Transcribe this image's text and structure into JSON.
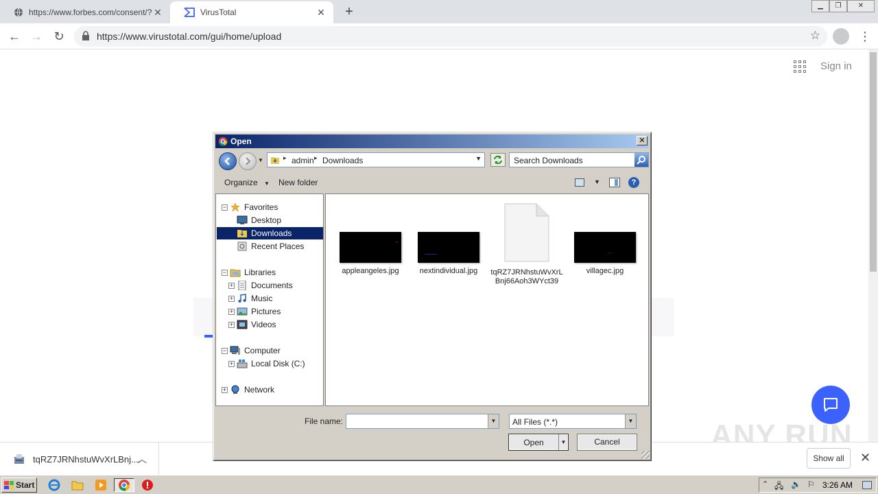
{
  "browser": {
    "tabs": [
      {
        "title": "https://www.forbes.com/consent/?t",
        "active": false,
        "icon": "globe-icon"
      },
      {
        "title": "VirusTotal",
        "active": true,
        "icon": "virustotal-icon"
      }
    ],
    "url": "https://www.virustotal.com/gui/home/upload"
  },
  "page": {
    "sign_in": "Sign in",
    "watermark": "ANY RUN"
  },
  "dialog": {
    "title": "Open",
    "breadcrumb": [
      "admin",
      "Downloads"
    ],
    "search_placeholder": "Search Downloads",
    "organize": "Organize",
    "new_folder": "New folder",
    "nav": {
      "favorites": "Favorites",
      "desktop": "Desktop",
      "downloads": "Downloads",
      "recent_places": "Recent Places",
      "libraries": "Libraries",
      "documents": "Documents",
      "music": "Music",
      "pictures": "Pictures",
      "videos": "Videos",
      "computer": "Computer",
      "local_disk": "Local Disk (C:)",
      "network": "Network"
    },
    "files": [
      {
        "name": "appleangeles.jpg",
        "type": "image"
      },
      {
        "name": "nextindividual.jpg",
        "type": "image"
      },
      {
        "name": "tqRZ7JRNhstuWvXrLBnj66Aoh3WYct39",
        "type": "document"
      },
      {
        "name": "villagec.jpg",
        "type": "image"
      }
    ],
    "file_name_label": "File name:",
    "file_name_value": "",
    "filter": "All Files (*.*)",
    "open_button": "Open",
    "cancel_button": "Cancel"
  },
  "download_bar": {
    "file_name": "tqRZ7JRNhstuWvXrLBnj....",
    "show_all": "Show all"
  },
  "taskbar": {
    "start": "Start",
    "clock": "3:26 AM"
  },
  "colors": {
    "accent": "#3b61ff",
    "title_bar": "#0a246a",
    "selection": "#0a246a"
  }
}
